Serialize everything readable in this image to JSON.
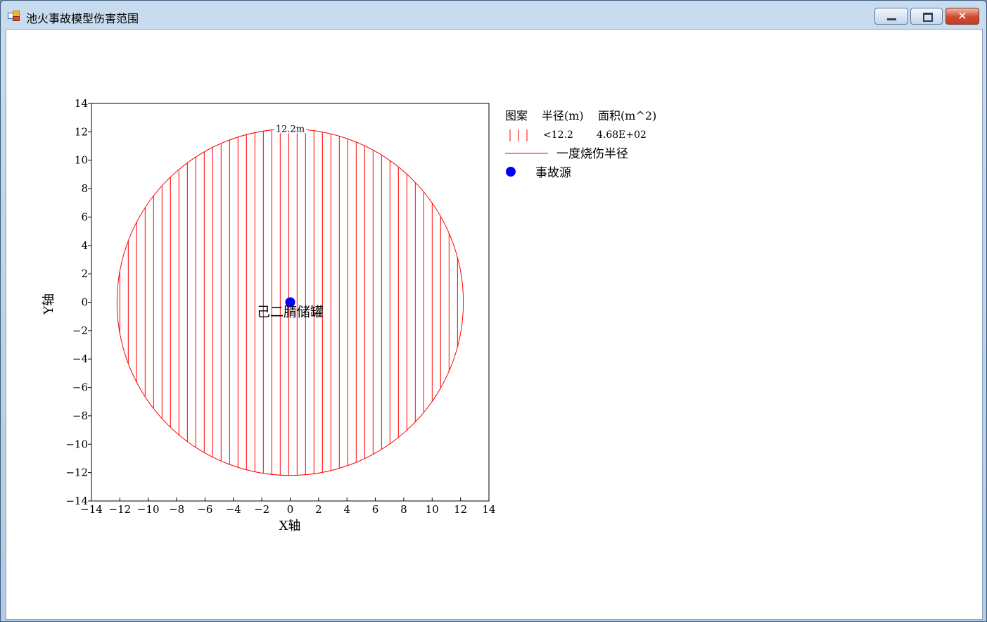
{
  "window": {
    "title": "池火事故模型伤害范围",
    "controls": {
      "minimize": "",
      "maximize": "",
      "close": "✕"
    }
  },
  "colors": {
    "fill_hatch": "#ff0000",
    "boundary": "#ff0000",
    "source": "#0000ff",
    "text": "#000000"
  },
  "chart_data": {
    "type": "scatter",
    "xlabel": "X轴",
    "ylabel": "Y轴",
    "xlim": [
      -14,
      14
    ],
    "ylim": [
      -14,
      14
    ],
    "x_ticks": [
      -14,
      -12,
      -10,
      -8,
      -6,
      -4,
      -2,
      0,
      2,
      4,
      6,
      8,
      10,
      12,
      14
    ],
    "y_ticks": [
      -14,
      -12,
      -10,
      -8,
      -6,
      -4,
      -2,
      0,
      2,
      4,
      6,
      8,
      10,
      12,
      14
    ],
    "grid": false,
    "source": {
      "x": 0,
      "y": 0,
      "label": "己二腈储罐"
    },
    "zone": {
      "radius": 12.2,
      "label": "12.2m",
      "pattern": "vertical-hatch"
    },
    "legend": {
      "position": "right",
      "headers": [
        "图案",
        "半径(m)",
        "面积(m^2)"
      ],
      "rows": [
        {
          "symbol": "vertical-hatch",
          "radius": "<12.2",
          "area": "4.68E+02"
        },
        {
          "symbol": "line",
          "label": "一度烧伤半径"
        },
        {
          "symbol": "dot",
          "label": "事故源"
        }
      ]
    }
  }
}
